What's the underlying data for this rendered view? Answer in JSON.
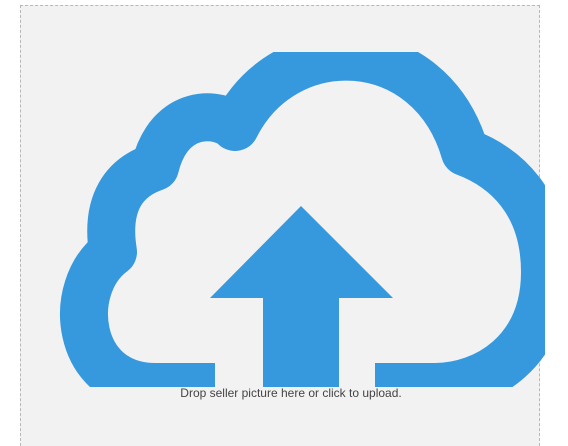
{
  "dropzone": {
    "hint_text": "Drop seller picture here or click to upload.",
    "icon": "cloud-upload-icon",
    "colors": {
      "icon": "#3799dd",
      "background": "#f2f2f3",
      "border": "#b8b8b8",
      "text": "#444444"
    }
  }
}
